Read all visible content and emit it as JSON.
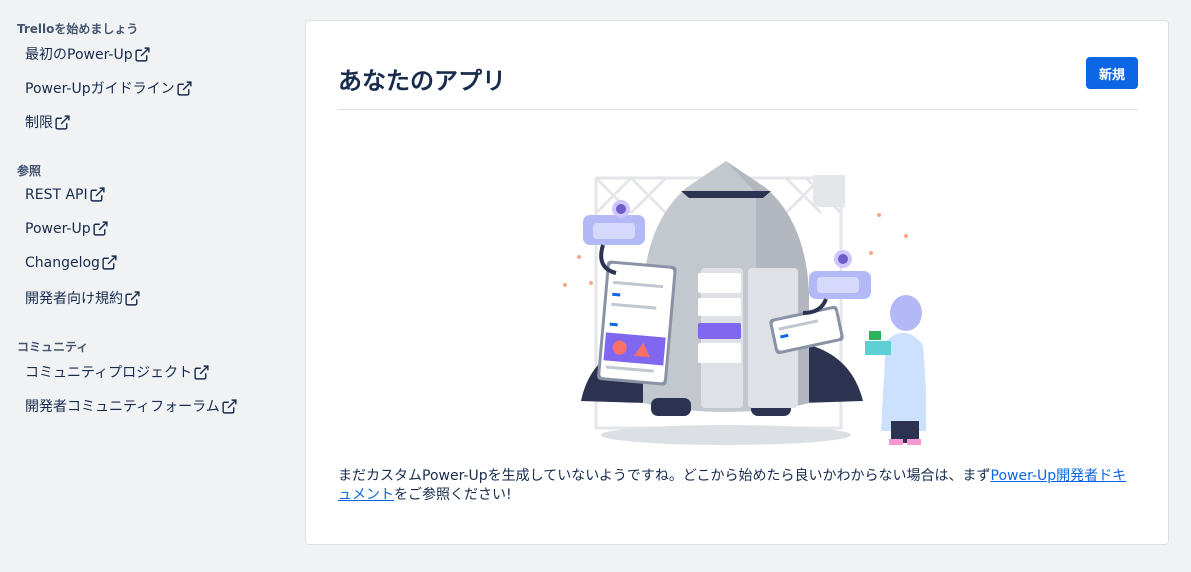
{
  "sidebar": {
    "sections": [
      {
        "title": "Trelloを始めましょう",
        "items": [
          {
            "label": "最初のPower-Up"
          },
          {
            "label": "Power-Upガイドライン"
          },
          {
            "label": "制限"
          }
        ]
      },
      {
        "title": "参照",
        "items": [
          {
            "label": "REST API"
          },
          {
            "label": "Power-Up"
          },
          {
            "label": "Changelog"
          },
          {
            "label": "開発者向け規約"
          }
        ]
      },
      {
        "title": "コミュニティ",
        "items": [
          {
            "label": "コミュニティプロジェクト"
          },
          {
            "label": "開発者コミュニティフォーラム"
          }
        ]
      }
    ]
  },
  "main": {
    "title": "あなたのアプリ",
    "new_button_label": "新規",
    "empty_state": {
      "text_before": "まだカスタムPower-Upを生成していないようですね。どこから始めたら良いかわからない場合は、まず",
      "link_text": "Power-Up開発者ドキュメント",
      "text_after": "をご参照ください!"
    }
  },
  "colors": {
    "accent": "#0c66e4",
    "background": "#f1f2f4",
    "panel": "#ffffff"
  }
}
